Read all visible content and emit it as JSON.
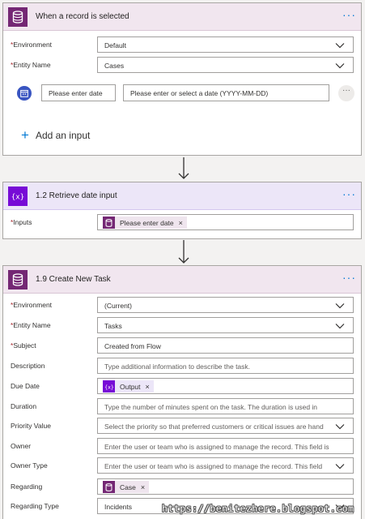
{
  "trigger": {
    "title": "When a record is selected",
    "more": "···",
    "fields": [
      {
        "label": "Environment",
        "required": "*",
        "value": "Default"
      },
      {
        "label": "Entity Name",
        "required": "*",
        "value": "Cases"
      }
    ],
    "date_input": {
      "name": "Please enter date",
      "placeholder": "Please enter or select a date (YYYY-MM-DD)",
      "more": "···"
    },
    "add_input": {
      "plus": "+",
      "label": "Add an input"
    }
  },
  "compose": {
    "title": "1.2 Retrieve date input",
    "more": "···",
    "inputs_label": "Inputs",
    "required": "*",
    "token": "Please enter date",
    "token_remove": "×"
  },
  "create_task": {
    "title": "1.9 Create New Task",
    "more": "···",
    "fields": [
      {
        "label": "Environment",
        "required": "*",
        "value": "(Current)",
        "placeholder": false
      },
      {
        "label": "Entity Name",
        "required": "*",
        "value": "Tasks",
        "placeholder": false
      },
      {
        "label": "Subject",
        "required": "*",
        "value": "Created from Flow",
        "placeholder": false
      },
      {
        "label": "Description",
        "required": "",
        "value": "Type additional information to describe the task.",
        "placeholder": true
      },
      {
        "label": "Due Date",
        "required": "",
        "token": "Output",
        "token_remove": "×"
      },
      {
        "label": "Duration",
        "required": "",
        "value": "Type the number of minutes spent on the task. The duration is used in",
        "placeholder": true
      },
      {
        "label": "Priority Value",
        "required": "",
        "value": "Select the priority so that preferred customers or critical issues are hand",
        "placeholder": true
      },
      {
        "label": "Owner",
        "required": "",
        "value": "Enter the user or team who is assigned to manage the record. This field is",
        "placeholder": true
      },
      {
        "label": "Owner Type",
        "required": "",
        "value": "Enter the user or team who is assigned to manage the record. This field",
        "placeholder": true
      },
      {
        "label": "Regarding",
        "required": "",
        "token": "Case",
        "token_remove": "×"
      },
      {
        "label": "Regarding Type",
        "required": "",
        "value": "Incidents",
        "placeholder": false
      }
    ]
  },
  "watermark": "https://benitezhere.blogspot.com",
  "colors": {
    "accent": "#0078d4",
    "cds": "#742774",
    "variable": "#770bd6",
    "date": "#3955c1",
    "required": "#a4262c"
  }
}
